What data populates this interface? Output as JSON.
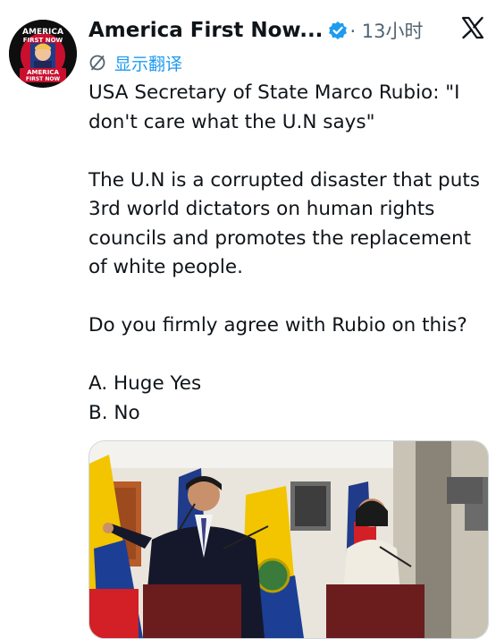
{
  "account": {
    "display_name": "America First Now...",
    "time": "· 13小时",
    "avatar_text_1": "AMERICA",
    "avatar_text_2": "FIRST NOW",
    "avatar_badge_1": "AMERICA",
    "avatar_badge_2": "FIRST NOW"
  },
  "translate_label": "显示翻译",
  "tweet": {
    "text": "USA Secretary of State Marco Rubio: \"I don't care what the U.N says\"\n\nThe U.N is a corrupted disaster that puts 3rd world dictators on human rights councils and promotes the replacement of white people.\n\nDo you firmly agree with Rubio on this?\n\nA. Huge Yes\nB. No"
  },
  "icons": {
    "verified": "verified-badge-icon",
    "translate": "translate-icon",
    "logo": "x-logo-icon"
  },
  "colors": {
    "accent": "#1d9bf0",
    "text": "#0f1419",
    "muted": "#536471"
  }
}
